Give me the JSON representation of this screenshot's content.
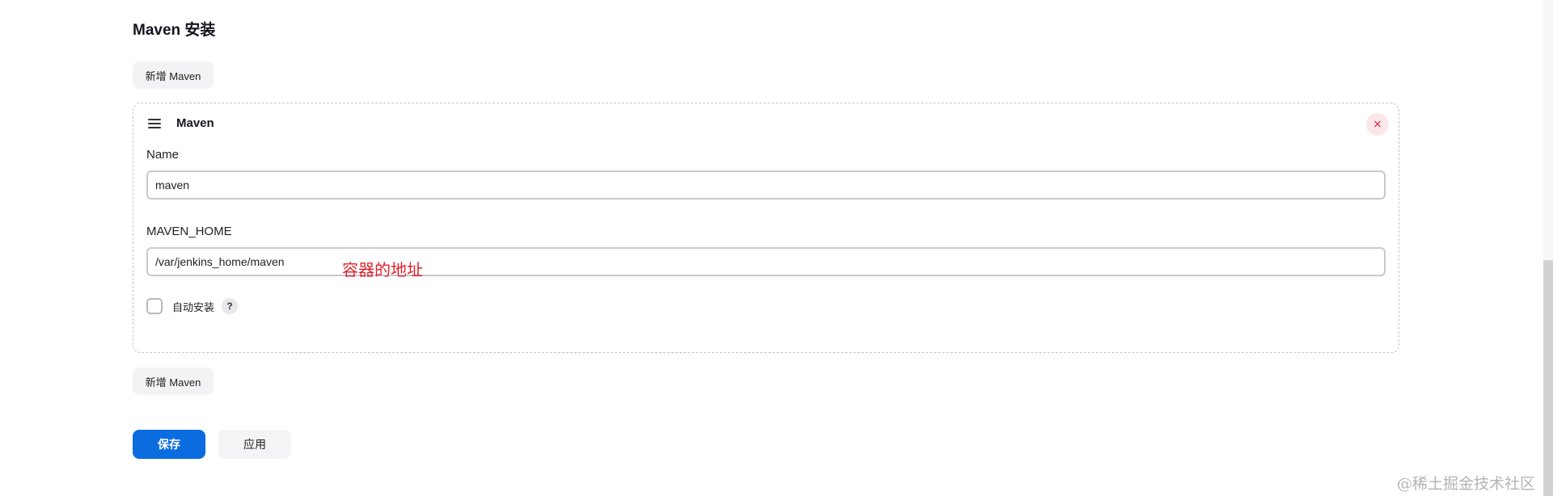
{
  "section": {
    "title": "Maven 安装"
  },
  "buttons": {
    "add_maven": "新增 Maven",
    "save": "保存",
    "apply": "应用"
  },
  "panel": {
    "title": "Maven",
    "close_symbol": "×",
    "name_label": "Name",
    "name_value": "maven",
    "home_label": "MAVEN_HOME",
    "home_value": "/var/jenkins_home/maven",
    "annotation": "容器的地址",
    "auto_install_label": "自动安装",
    "auto_install_checked": false,
    "help_symbol": "?"
  },
  "watermark": "@稀土掘金技术社区",
  "colors": {
    "primary": "#0b6ce0",
    "danger": "#d3243a",
    "annotation": "#e0212b"
  },
  "icons": {
    "drag": "drag-handle-icon",
    "close": "close-icon",
    "help": "help-icon"
  }
}
